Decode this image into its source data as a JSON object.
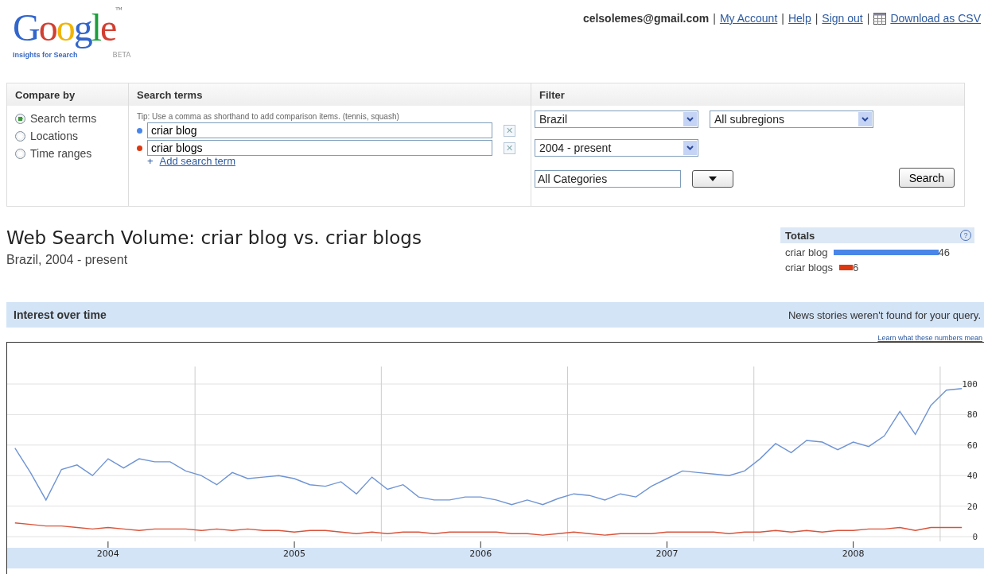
{
  "logo": {
    "word": "Google",
    "tm": "™",
    "subtitle": "Insights for Search",
    "badge": "BETA"
  },
  "account": {
    "email": "celsolemes@gmail.com",
    "separator": "|",
    "links": [
      {
        "label": "My Account"
      },
      {
        "label": "Help"
      },
      {
        "label": "Sign out"
      },
      {
        "label": "Download as CSV",
        "kind": "csv"
      }
    ]
  },
  "compare_by": {
    "heading": "Compare by",
    "options": [
      {
        "label": "Search terms",
        "selected": true
      },
      {
        "label": "Locations",
        "selected": false
      },
      {
        "label": "Time ranges",
        "selected": false
      }
    ]
  },
  "search_terms": {
    "heading": "Search terms",
    "tip": "Tip: Use a comma as shorthand to add comparison items. (tennis, squash)",
    "terms": [
      {
        "value": "criar blog",
        "color": "#4a86e8"
      },
      {
        "value": "criar blogs",
        "color": "#dc3912"
      }
    ],
    "add_link": "Add search term",
    "add_mark": "+",
    "remove_mark": "✕"
  },
  "filter": {
    "heading": "Filter",
    "selects": [
      {
        "value": "Brazil"
      },
      {
        "value": "All subregions"
      },
      {
        "value": "2004 - present"
      }
    ],
    "category": "All Categories",
    "search_button": "Search"
  },
  "title": "Web Search Volume: criar blog vs. criar blogs",
  "subtitle": "Brazil, 2004 - present",
  "totals": {
    "heading": "Totals",
    "help": "?",
    "items": [
      {
        "term": "criar blog",
        "value": "46",
        "color": "#4a86e8"
      },
      {
        "term": "criar blogs",
        "value": "6",
        "color": "#dc3912"
      }
    ]
  },
  "interest": {
    "heading": "Interest over time",
    "news": "News stories weren't found for your query.",
    "learn_link": "Learn what these numbers mean",
    "chart_data": {
      "type": "line",
      "grid": true,
      "ylim": [
        0,
        100
      ],
      "yticks": [
        0,
        20,
        40,
        60,
        80,
        100
      ],
      "categories": [
        null,
        null,
        null,
        null,
        null,
        null,
        "2004",
        null,
        null,
        null,
        null,
        null,
        null,
        null,
        null,
        null,
        null,
        null,
        "2005",
        null,
        null,
        null,
        null,
        null,
        null,
        null,
        null,
        null,
        null,
        null,
        "2006",
        null,
        null,
        null,
        null,
        null,
        null,
        null,
        null,
        null,
        null,
        null,
        "2007",
        null,
        null,
        null,
        null,
        null,
        null,
        null,
        null,
        null,
        null,
        null,
        "2008",
        null,
        null,
        null,
        null,
        null,
        null,
        null
      ],
      "series": [
        {
          "color": "#6f94d4",
          "values": [
            58,
            42,
            24,
            44,
            47,
            40,
            51,
            45,
            51,
            49,
            49,
            43,
            40,
            34,
            42,
            38,
            39,
            40,
            38,
            34,
            33,
            36,
            28,
            39,
            31,
            34,
            26,
            24,
            24,
            26,
            26,
            24,
            21,
            24,
            21,
            25,
            28,
            27,
            24,
            28,
            26,
            33,
            38,
            43,
            42,
            41,
            40,
            43,
            51,
            61,
            55,
            63,
            62,
            57,
            62,
            59,
            66,
            82,
            67,
            86,
            96,
            97
          ]
        },
        {
          "color": "#d9533a",
          "values": [
            9,
            8,
            7,
            7,
            6,
            5,
            6,
            5,
            4,
            5,
            5,
            5,
            4,
            5,
            4,
            5,
            4,
            4,
            3,
            4,
            4,
            3,
            2,
            3,
            2,
            3,
            3,
            2,
            3,
            3,
            3,
            3,
            2,
            2,
            1,
            2,
            3,
            2,
            1,
            2,
            2,
            2,
            3,
            3,
            3,
            3,
            2,
            3,
            3,
            4,
            3,
            4,
            3,
            4,
            4,
            5,
            5,
            6,
            4,
            6,
            6,
            6
          ]
        }
      ]
    }
  }
}
